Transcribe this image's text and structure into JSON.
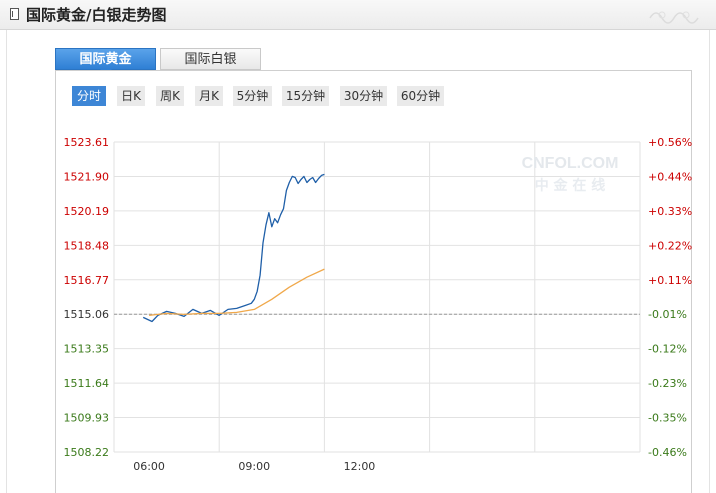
{
  "header": {
    "title": "国际黄金/白银走势图"
  },
  "tabs": [
    {
      "label": "国际黄金",
      "active": true
    },
    {
      "label": "国际白银",
      "active": false
    }
  ],
  "periods": [
    {
      "label": "分时",
      "active": true
    },
    {
      "label": "日K"
    },
    {
      "label": "周K"
    },
    {
      "label": "月K"
    },
    {
      "label": "5分钟"
    },
    {
      "label": "15分钟"
    },
    {
      "label": "30分钟"
    },
    {
      "label": "60分钟"
    }
  ],
  "watermark": {
    "brand": "CNFOL.COM",
    "cn": "中 金 在 线"
  },
  "colors": {
    "price": "#1f5fa8",
    "average": "#f0a84a",
    "up": "#cc0000",
    "down": "#3a7a1a",
    "accent": "#2f7fd4"
  },
  "chart_data": {
    "type": "line",
    "yticks": [
      "1523.61",
      "1521.90",
      "1520.19",
      "1518.48",
      "1516.77",
      "1515.06",
      "1513.35",
      "1511.64",
      "1509.93",
      "1508.22"
    ],
    "pct_ticks": [
      "+0.56%",
      "+0.44%",
      "+0.33%",
      "+0.22%",
      "+0.11%",
      "-0.01%",
      "-0.12%",
      "-0.23%",
      "-0.35%",
      "-0.46%"
    ],
    "xticks": [
      "06:00",
      "09:00",
      "12:00"
    ],
    "ylim": [
      1508.22,
      1523.61
    ],
    "reference": 1515.06,
    "series": [
      {
        "role": "price",
        "x": [
          "05:50",
          "06:05",
          "06:15",
          "06:30",
          "06:45",
          "07:00",
          "07:15",
          "07:30",
          "07:45",
          "08:00",
          "08:15",
          "08:30",
          "08:45",
          "08:55",
          "09:00",
          "09:05",
          "09:10",
          "09:15",
          "09:20",
          "09:25",
          "09:30",
          "09:35",
          "09:40",
          "09:45",
          "09:50",
          "09:55",
          "10:00",
          "10:05",
          "10:10",
          "10:15",
          "10:20",
          "10:25",
          "10:30",
          "10:35",
          "10:40",
          "10:45",
          "10:50",
          "10:55",
          "11:00"
        ],
        "values": [
          1514.9,
          1514.7,
          1515.0,
          1515.2,
          1515.1,
          1514.95,
          1515.3,
          1515.1,
          1515.25,
          1515.0,
          1515.3,
          1515.35,
          1515.5,
          1515.6,
          1515.8,
          1516.2,
          1517.0,
          1518.6,
          1519.5,
          1520.1,
          1519.4,
          1519.8,
          1519.6,
          1520.0,
          1520.3,
          1521.2,
          1521.6,
          1521.9,
          1521.85,
          1521.55,
          1521.75,
          1521.9,
          1521.6,
          1521.75,
          1521.85,
          1521.6,
          1521.8,
          1521.95,
          1522.0
        ]
      },
      {
        "role": "average",
        "x": [
          "06:00",
          "06:30",
          "07:00",
          "07:30",
          "08:00",
          "08:30",
          "09:00",
          "09:30",
          "10:00",
          "10:30",
          "11:00"
        ],
        "values": [
          1515.0,
          1515.1,
          1515.05,
          1515.1,
          1515.1,
          1515.15,
          1515.3,
          1515.8,
          1516.4,
          1516.9,
          1517.3
        ]
      }
    ]
  }
}
